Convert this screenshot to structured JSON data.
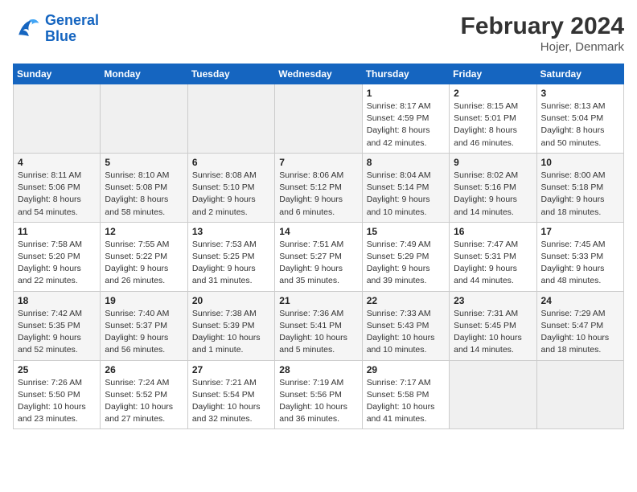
{
  "header": {
    "logo_line1": "General",
    "logo_line2": "Blue",
    "month_year": "February 2024",
    "location": "Hojer, Denmark"
  },
  "days_of_week": [
    "Sunday",
    "Monday",
    "Tuesday",
    "Wednesday",
    "Thursday",
    "Friday",
    "Saturday"
  ],
  "weeks": [
    [
      {
        "day": "",
        "info": ""
      },
      {
        "day": "",
        "info": ""
      },
      {
        "day": "",
        "info": ""
      },
      {
        "day": "",
        "info": ""
      },
      {
        "day": "1",
        "info": "Sunrise: 8:17 AM\nSunset: 4:59 PM\nDaylight: 8 hours\nand 42 minutes."
      },
      {
        "day": "2",
        "info": "Sunrise: 8:15 AM\nSunset: 5:01 PM\nDaylight: 8 hours\nand 46 minutes."
      },
      {
        "day": "3",
        "info": "Sunrise: 8:13 AM\nSunset: 5:04 PM\nDaylight: 8 hours\nand 50 minutes."
      }
    ],
    [
      {
        "day": "4",
        "info": "Sunrise: 8:11 AM\nSunset: 5:06 PM\nDaylight: 8 hours\nand 54 minutes."
      },
      {
        "day": "5",
        "info": "Sunrise: 8:10 AM\nSunset: 5:08 PM\nDaylight: 8 hours\nand 58 minutes."
      },
      {
        "day": "6",
        "info": "Sunrise: 8:08 AM\nSunset: 5:10 PM\nDaylight: 9 hours\nand 2 minutes."
      },
      {
        "day": "7",
        "info": "Sunrise: 8:06 AM\nSunset: 5:12 PM\nDaylight: 9 hours\nand 6 minutes."
      },
      {
        "day": "8",
        "info": "Sunrise: 8:04 AM\nSunset: 5:14 PM\nDaylight: 9 hours\nand 10 minutes."
      },
      {
        "day": "9",
        "info": "Sunrise: 8:02 AM\nSunset: 5:16 PM\nDaylight: 9 hours\nand 14 minutes."
      },
      {
        "day": "10",
        "info": "Sunrise: 8:00 AM\nSunset: 5:18 PM\nDaylight: 9 hours\nand 18 minutes."
      }
    ],
    [
      {
        "day": "11",
        "info": "Sunrise: 7:58 AM\nSunset: 5:20 PM\nDaylight: 9 hours\nand 22 minutes."
      },
      {
        "day": "12",
        "info": "Sunrise: 7:55 AM\nSunset: 5:22 PM\nDaylight: 9 hours\nand 26 minutes."
      },
      {
        "day": "13",
        "info": "Sunrise: 7:53 AM\nSunset: 5:25 PM\nDaylight: 9 hours\nand 31 minutes."
      },
      {
        "day": "14",
        "info": "Sunrise: 7:51 AM\nSunset: 5:27 PM\nDaylight: 9 hours\nand 35 minutes."
      },
      {
        "day": "15",
        "info": "Sunrise: 7:49 AM\nSunset: 5:29 PM\nDaylight: 9 hours\nand 39 minutes."
      },
      {
        "day": "16",
        "info": "Sunrise: 7:47 AM\nSunset: 5:31 PM\nDaylight: 9 hours\nand 44 minutes."
      },
      {
        "day": "17",
        "info": "Sunrise: 7:45 AM\nSunset: 5:33 PM\nDaylight: 9 hours\nand 48 minutes."
      }
    ],
    [
      {
        "day": "18",
        "info": "Sunrise: 7:42 AM\nSunset: 5:35 PM\nDaylight: 9 hours\nand 52 minutes."
      },
      {
        "day": "19",
        "info": "Sunrise: 7:40 AM\nSunset: 5:37 PM\nDaylight: 9 hours\nand 56 minutes."
      },
      {
        "day": "20",
        "info": "Sunrise: 7:38 AM\nSunset: 5:39 PM\nDaylight: 10 hours\nand 1 minute."
      },
      {
        "day": "21",
        "info": "Sunrise: 7:36 AM\nSunset: 5:41 PM\nDaylight: 10 hours\nand 5 minutes."
      },
      {
        "day": "22",
        "info": "Sunrise: 7:33 AM\nSunset: 5:43 PM\nDaylight: 10 hours\nand 10 minutes."
      },
      {
        "day": "23",
        "info": "Sunrise: 7:31 AM\nSunset: 5:45 PM\nDaylight: 10 hours\nand 14 minutes."
      },
      {
        "day": "24",
        "info": "Sunrise: 7:29 AM\nSunset: 5:47 PM\nDaylight: 10 hours\nand 18 minutes."
      }
    ],
    [
      {
        "day": "25",
        "info": "Sunrise: 7:26 AM\nSunset: 5:50 PM\nDaylight: 10 hours\nand 23 minutes."
      },
      {
        "day": "26",
        "info": "Sunrise: 7:24 AM\nSunset: 5:52 PM\nDaylight: 10 hours\nand 27 minutes."
      },
      {
        "day": "27",
        "info": "Sunrise: 7:21 AM\nSunset: 5:54 PM\nDaylight: 10 hours\nand 32 minutes."
      },
      {
        "day": "28",
        "info": "Sunrise: 7:19 AM\nSunset: 5:56 PM\nDaylight: 10 hours\nand 36 minutes."
      },
      {
        "day": "29",
        "info": "Sunrise: 7:17 AM\nSunset: 5:58 PM\nDaylight: 10 hours\nand 41 minutes."
      },
      {
        "day": "",
        "info": ""
      },
      {
        "day": "",
        "info": ""
      }
    ]
  ]
}
